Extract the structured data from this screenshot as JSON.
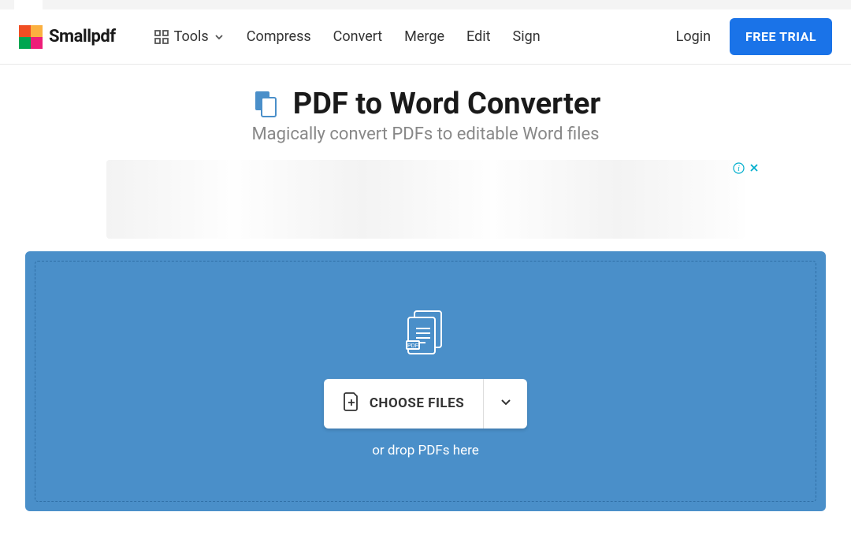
{
  "brand": {
    "name": "Smallpdf"
  },
  "nav": {
    "tools_label": "Tools",
    "items": [
      "Compress",
      "Convert",
      "Merge",
      "Edit",
      "Sign"
    ]
  },
  "actions": {
    "login": "Login",
    "free_trial": "FREE TRIAL"
  },
  "page": {
    "title": "PDF to Word Converter",
    "subtitle": "Magically convert PDFs to editable Word files"
  },
  "dropzone": {
    "choose_label": "CHOOSE FILES",
    "hint": "or drop PDFs here"
  }
}
